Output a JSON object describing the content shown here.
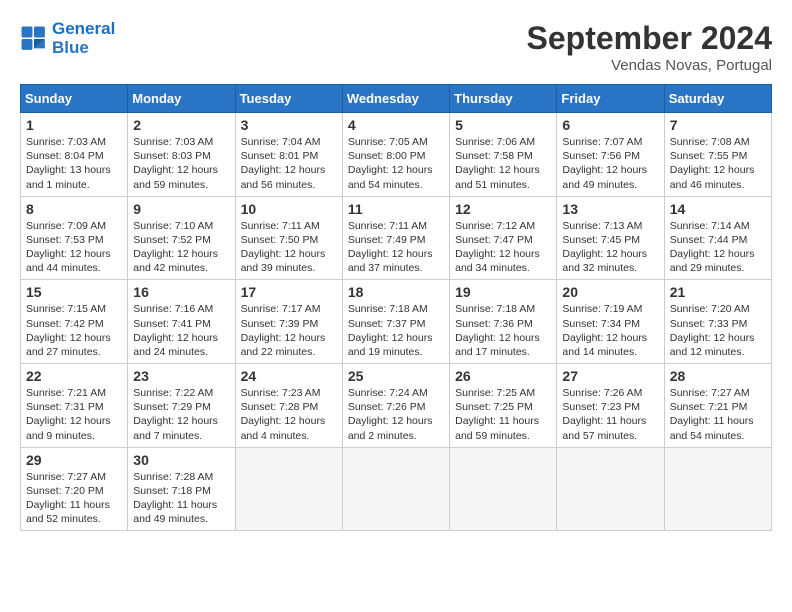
{
  "logo": {
    "line1": "General",
    "line2": "Blue"
  },
  "title": "September 2024",
  "location": "Vendas Novas, Portugal",
  "weekdays": [
    "Sunday",
    "Monday",
    "Tuesday",
    "Wednesday",
    "Thursday",
    "Friday",
    "Saturday"
  ],
  "weeks": [
    [
      {
        "day": 1,
        "info": "Sunrise: 7:03 AM\nSunset: 8:04 PM\nDaylight: 13 hours\nand 1 minute."
      },
      {
        "day": 2,
        "info": "Sunrise: 7:03 AM\nSunset: 8:03 PM\nDaylight: 12 hours\nand 59 minutes."
      },
      {
        "day": 3,
        "info": "Sunrise: 7:04 AM\nSunset: 8:01 PM\nDaylight: 12 hours\nand 56 minutes."
      },
      {
        "day": 4,
        "info": "Sunrise: 7:05 AM\nSunset: 8:00 PM\nDaylight: 12 hours\nand 54 minutes."
      },
      {
        "day": 5,
        "info": "Sunrise: 7:06 AM\nSunset: 7:58 PM\nDaylight: 12 hours\nand 51 minutes."
      },
      {
        "day": 6,
        "info": "Sunrise: 7:07 AM\nSunset: 7:56 PM\nDaylight: 12 hours\nand 49 minutes."
      },
      {
        "day": 7,
        "info": "Sunrise: 7:08 AM\nSunset: 7:55 PM\nDaylight: 12 hours\nand 46 minutes."
      }
    ],
    [
      {
        "day": 8,
        "info": "Sunrise: 7:09 AM\nSunset: 7:53 PM\nDaylight: 12 hours\nand 44 minutes."
      },
      {
        "day": 9,
        "info": "Sunrise: 7:10 AM\nSunset: 7:52 PM\nDaylight: 12 hours\nand 42 minutes."
      },
      {
        "day": 10,
        "info": "Sunrise: 7:11 AM\nSunset: 7:50 PM\nDaylight: 12 hours\nand 39 minutes."
      },
      {
        "day": 11,
        "info": "Sunrise: 7:11 AM\nSunset: 7:49 PM\nDaylight: 12 hours\nand 37 minutes."
      },
      {
        "day": 12,
        "info": "Sunrise: 7:12 AM\nSunset: 7:47 PM\nDaylight: 12 hours\nand 34 minutes."
      },
      {
        "day": 13,
        "info": "Sunrise: 7:13 AM\nSunset: 7:45 PM\nDaylight: 12 hours\nand 32 minutes."
      },
      {
        "day": 14,
        "info": "Sunrise: 7:14 AM\nSunset: 7:44 PM\nDaylight: 12 hours\nand 29 minutes."
      }
    ],
    [
      {
        "day": 15,
        "info": "Sunrise: 7:15 AM\nSunset: 7:42 PM\nDaylight: 12 hours\nand 27 minutes."
      },
      {
        "day": 16,
        "info": "Sunrise: 7:16 AM\nSunset: 7:41 PM\nDaylight: 12 hours\nand 24 minutes."
      },
      {
        "day": 17,
        "info": "Sunrise: 7:17 AM\nSunset: 7:39 PM\nDaylight: 12 hours\nand 22 minutes."
      },
      {
        "day": 18,
        "info": "Sunrise: 7:18 AM\nSunset: 7:37 PM\nDaylight: 12 hours\nand 19 minutes."
      },
      {
        "day": 19,
        "info": "Sunrise: 7:18 AM\nSunset: 7:36 PM\nDaylight: 12 hours\nand 17 minutes."
      },
      {
        "day": 20,
        "info": "Sunrise: 7:19 AM\nSunset: 7:34 PM\nDaylight: 12 hours\nand 14 minutes."
      },
      {
        "day": 21,
        "info": "Sunrise: 7:20 AM\nSunset: 7:33 PM\nDaylight: 12 hours\nand 12 minutes."
      }
    ],
    [
      {
        "day": 22,
        "info": "Sunrise: 7:21 AM\nSunset: 7:31 PM\nDaylight: 12 hours\nand 9 minutes."
      },
      {
        "day": 23,
        "info": "Sunrise: 7:22 AM\nSunset: 7:29 PM\nDaylight: 12 hours\nand 7 minutes."
      },
      {
        "day": 24,
        "info": "Sunrise: 7:23 AM\nSunset: 7:28 PM\nDaylight: 12 hours\nand 4 minutes."
      },
      {
        "day": 25,
        "info": "Sunrise: 7:24 AM\nSunset: 7:26 PM\nDaylight: 12 hours\nand 2 minutes."
      },
      {
        "day": 26,
        "info": "Sunrise: 7:25 AM\nSunset: 7:25 PM\nDaylight: 11 hours\nand 59 minutes."
      },
      {
        "day": 27,
        "info": "Sunrise: 7:26 AM\nSunset: 7:23 PM\nDaylight: 11 hours\nand 57 minutes."
      },
      {
        "day": 28,
        "info": "Sunrise: 7:27 AM\nSunset: 7:21 PM\nDaylight: 11 hours\nand 54 minutes."
      }
    ],
    [
      {
        "day": 29,
        "info": "Sunrise: 7:27 AM\nSunset: 7:20 PM\nDaylight: 11 hours\nand 52 minutes."
      },
      {
        "day": 30,
        "info": "Sunrise: 7:28 AM\nSunset: 7:18 PM\nDaylight: 11 hours\nand 49 minutes."
      },
      null,
      null,
      null,
      null,
      null
    ]
  ]
}
